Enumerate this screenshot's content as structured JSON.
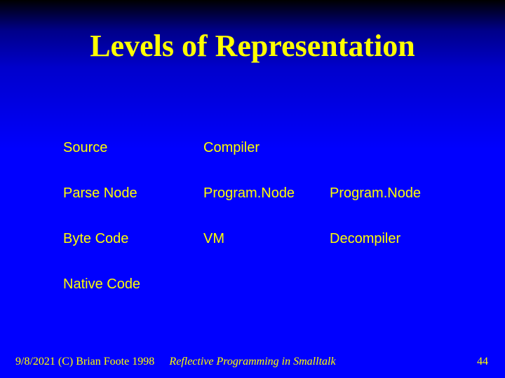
{
  "title": "Levels of Representation",
  "rows": [
    {
      "c1": "Source",
      "c2": "Compiler",
      "c3": ""
    },
    {
      "c1": "Parse Node",
      "c2": "Program.Node",
      "c3": "Program.Node"
    },
    {
      "c1": "Byte Code",
      "c2": "VM",
      "c3": "Decompiler"
    },
    {
      "c1": "Native Code",
      "c2": "",
      "c3": ""
    }
  ],
  "footer": {
    "left": "9/8/2021 (C) Brian Foote 1998",
    "center": "Reflective Programming in Smalltalk",
    "right": "44"
  }
}
